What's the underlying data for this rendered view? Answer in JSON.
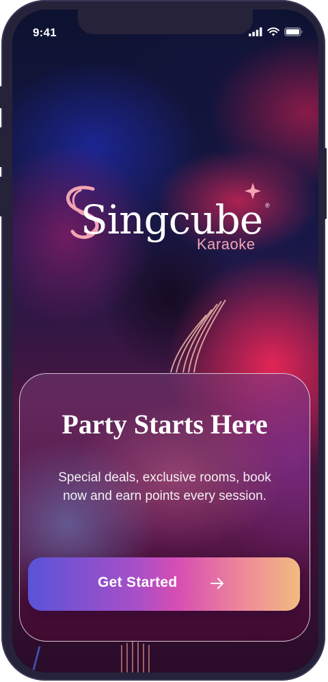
{
  "status_bar": {
    "time": "9:41"
  },
  "brand": {
    "name": "Singcube",
    "subtitle": "Karaoke",
    "registered_mark": "®",
    "logo_pink": "#f2a4b4"
  },
  "hero": {
    "title": "Party Starts Here",
    "description": "Special deals, exclusive rooms, book now and earn points every session.",
    "cta_label": "Get Started",
    "cta_icon": "arrow-right-icon"
  },
  "colors": {
    "device_frame": "#25223a",
    "cta_start": "#5a53d8",
    "cta_mid": "#d64eb3",
    "cta_end": "#f2bb80"
  }
}
